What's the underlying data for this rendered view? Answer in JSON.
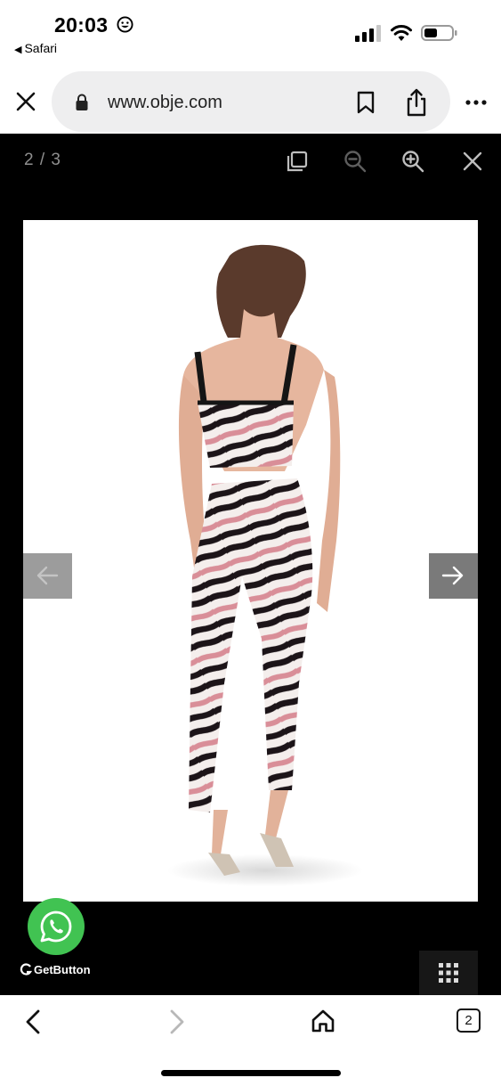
{
  "status_bar": {
    "time": "20:03",
    "back_app": "Safari",
    "icons": [
      "smiley-emoji",
      "cellular-signal",
      "wifi",
      "battery"
    ]
  },
  "browser": {
    "url": "www.obje.com",
    "icons": [
      "close-icon",
      "lock-icon",
      "bookmark-icon",
      "share-icon",
      "more-icon"
    ]
  },
  "lightbox": {
    "counter": "2 / 3",
    "tools": [
      "fullscreen-icon",
      "zoom-out-icon",
      "zoom-in-icon",
      "close-icon"
    ],
    "prev_arrow": "arrow-left-icon",
    "next_arrow": "arrow-right-icon",
    "image_subject": "zebra-print-crop-top-and-pants"
  },
  "widget": {
    "whatsapp_icon": "whatsapp-icon",
    "getbutton_label": "GetButton",
    "grid_icon": "grid-icon"
  },
  "toolbar": {
    "tabs_count": "2",
    "icons": [
      "back-icon",
      "forward-icon",
      "home-icon",
      "tabs-icon"
    ]
  },
  "colors": {
    "whatsapp_green": "#41c352",
    "lightbox_bg": "#000000",
    "url_pill_bg": "#eeeeef",
    "disabled_icon": "#b8b8b8"
  }
}
